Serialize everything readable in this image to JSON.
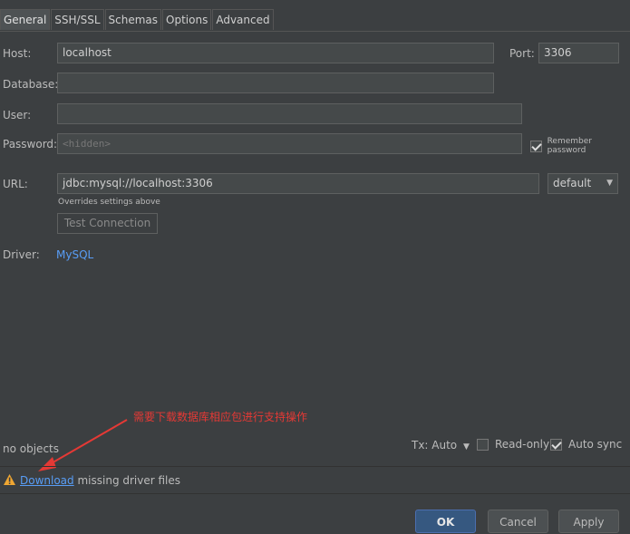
{
  "tabs": [
    "General",
    "SSH/SSL",
    "Schemas",
    "Options",
    "Advanced"
  ],
  "host": {
    "label": "Host:",
    "value": "localhost"
  },
  "port": {
    "label": "Port:",
    "value": "3306"
  },
  "database": {
    "label": "Database:",
    "value": ""
  },
  "user": {
    "label": "User:",
    "value": ""
  },
  "password": {
    "label": "Password:",
    "placeholder": "<hidden>"
  },
  "remember_password": {
    "label": "Remember password",
    "checked": true
  },
  "url": {
    "label": "URL:",
    "value": "jdbc:mysql://localhost:3306",
    "hint": "Overrides settings above"
  },
  "url_mode": "default",
  "test_connection": "Test Connection",
  "driver": {
    "label": "Driver:",
    "value": "MySQL"
  },
  "annotation": "需要下载数据库相应包进行支持操作",
  "objects_status": "no objects",
  "tx": "Tx: Auto",
  "read_only": {
    "label": "Read-only",
    "checked": false
  },
  "auto_sync": {
    "label": "Auto sync",
    "checked": true
  },
  "warning": {
    "link": "Download",
    "text": " missing driver files"
  },
  "buttons": {
    "ok": "OK",
    "cancel": "Cancel",
    "apply": "Apply"
  },
  "colors": {
    "background": "#3c3f41",
    "link": "#589df6",
    "annotation": "#e53935",
    "ok_button": "#365880"
  }
}
